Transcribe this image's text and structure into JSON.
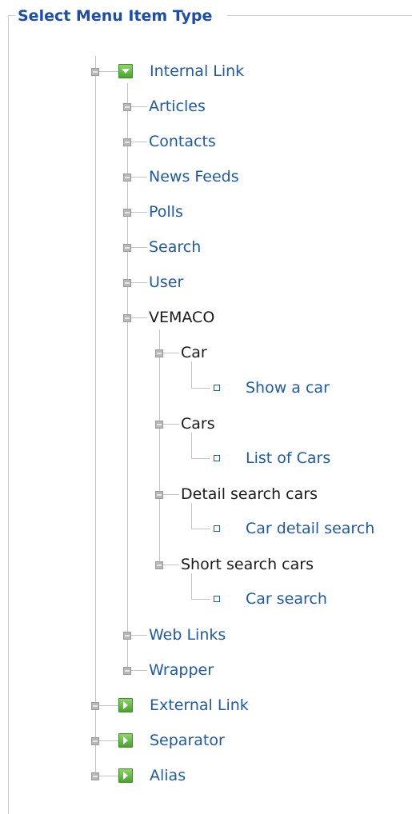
{
  "legend": "Select Menu Item Type",
  "tree": {
    "internal_link": "Internal Link",
    "articles": "Articles",
    "contacts": "Contacts",
    "news_feeds": "News Feeds",
    "polls": "Polls",
    "search": "Search",
    "user": "User",
    "vemaco": {
      "label": "VEMACO",
      "car": {
        "label": "Car",
        "leaf": "Show a car"
      },
      "cars": {
        "label": "Cars",
        "leaf": "List of Cars"
      },
      "detail": {
        "label": "Detail search cars",
        "leaf": "Car detail search"
      },
      "short": {
        "label": "Short search cars",
        "leaf": "Car search"
      }
    },
    "web_links": "Web Links",
    "wrapper": "Wrapper",
    "external_link": "External Link",
    "separator": "Separator",
    "alias": "Alias"
  },
  "colors": {
    "link": "#1e5aa8",
    "legend": "#1a4ea8",
    "icon": "#4aa42c"
  },
  "icons": {
    "expanded": "triangle-down",
    "collapsed": "triangle-right"
  }
}
